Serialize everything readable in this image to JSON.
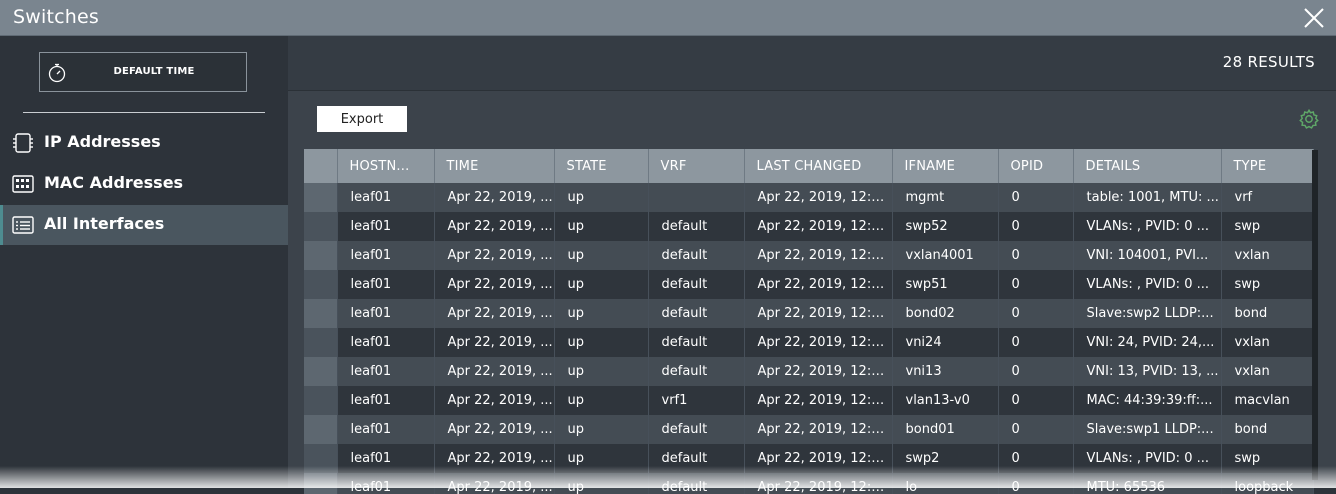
{
  "window": {
    "title": "Switches"
  },
  "sidebar": {
    "time_button": "DEFAULT TIME",
    "items": [
      {
        "label": "IP Addresses",
        "icon": "ip-address-icon",
        "active": false
      },
      {
        "label": "MAC Addresses",
        "icon": "mac-address-icon",
        "active": false
      },
      {
        "label": "All Interfaces",
        "icon": "interfaces-icon",
        "active": true
      }
    ]
  },
  "results": {
    "count_label": "28 RESULTS"
  },
  "toolbar": {
    "export_label": "Export"
  },
  "table": {
    "columns": [
      "HOSTN...",
      "TIME",
      "STATE",
      "VRF",
      "LAST CHANGED",
      "IFNAME",
      "OPID",
      "DETAILS",
      "TYPE"
    ],
    "rows": [
      [
        "leaf01",
        "Apr 22, 2019, ...",
        "up",
        "",
        "Apr 22, 2019, 12:3...",
        "mgmt",
        "0",
        "table: 1001, MTU: ...",
        "vrf"
      ],
      [
        "leaf01",
        "Apr 22, 2019, ...",
        "up",
        "default",
        "Apr 22, 2019, 12:3...",
        "swp52",
        "0",
        "VLANs: , PVID: 0 ...",
        "swp"
      ],
      [
        "leaf01",
        "Apr 22, 2019, ...",
        "up",
        "default",
        "Apr 22, 2019, 12:3...",
        "vxlan4001",
        "0",
        "VNI: 104001, PVI...",
        "vxlan"
      ],
      [
        "leaf01",
        "Apr 22, 2019, ...",
        "up",
        "default",
        "Apr 22, 2019, 12:3...",
        "swp51",
        "0",
        "VLANs: , PVID: 0 ...",
        "swp"
      ],
      [
        "leaf01",
        "Apr 22, 2019, ...",
        "up",
        "default",
        "Apr 22, 2019, 12:3...",
        "bond02",
        "0",
        "Slave:swp2 LLDP:...",
        "bond"
      ],
      [
        "leaf01",
        "Apr 22, 2019, ...",
        "up",
        "default",
        "Apr 22, 2019, 12:3...",
        "vni24",
        "0",
        "VNI: 24, PVID: 24,...",
        "vxlan"
      ],
      [
        "leaf01",
        "Apr 22, 2019, ...",
        "up",
        "default",
        "Apr 22, 2019, 12:3...",
        "vni13",
        "0",
        "VNI: 13, PVID: 13, ...",
        "vxlan"
      ],
      [
        "leaf01",
        "Apr 22, 2019, ...",
        "up",
        "vrf1",
        "Apr 22, 2019, 12:3...",
        "vlan13-v0",
        "0",
        "MAC: 44:39:39:ff:...",
        "macvlan"
      ],
      [
        "leaf01",
        "Apr 22, 2019, ...",
        "up",
        "default",
        "Apr 22, 2019, 12:3...",
        "bond01",
        "0",
        "Slave:swp1 LLDP:...",
        "bond"
      ],
      [
        "leaf01",
        "Apr 22, 2019, ...",
        "up",
        "default",
        "Apr 22, 2019, 12:3...",
        "swp2",
        "0",
        "VLANs: , PVID: 0 ...",
        "swp"
      ],
      [
        "leaf01",
        "Apr 22, 2019, ...",
        "up",
        "default",
        "Apr 22, 2019, 12:3...",
        "lo",
        "0",
        "MTU: 65536",
        "loopback"
      ]
    ]
  },
  "colors": {
    "accent": "#4e8c90",
    "gear": "#5fa868"
  }
}
